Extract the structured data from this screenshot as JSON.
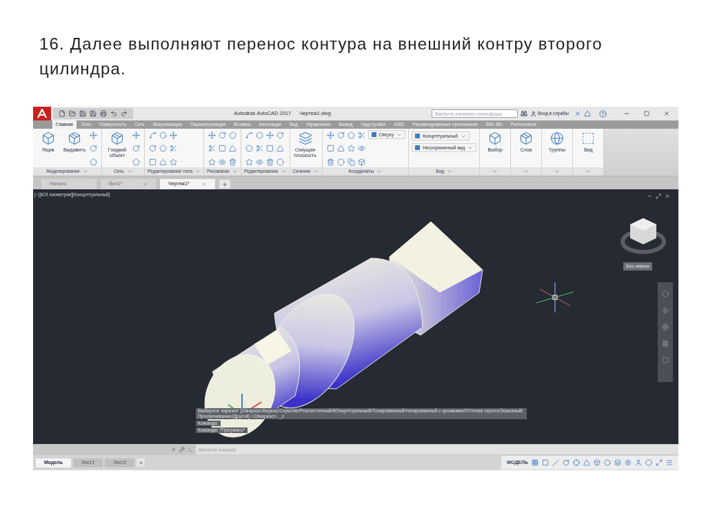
{
  "heading": "16. Далее выполняют перенос контура на внешний контру второго цилиндра.",
  "window": {
    "title": "Autodesk AutoCAD 2017",
    "file": "Чертеж1.dwg"
  },
  "search": {
    "placeholder": "Введите ключевое слово/фразу"
  },
  "sign_in": "Вход в службы",
  "ribbon_tabs": [
    {
      "label": "Главная",
      "selected": true
    },
    {
      "label": "Тело",
      "selected": false
    },
    {
      "label": "Поверхность",
      "selected": false
    },
    {
      "label": "Сеть",
      "selected": false
    },
    {
      "label": "Визуализация",
      "selected": false
    },
    {
      "label": "Параметризация",
      "selected": false
    },
    {
      "label": "Вставка",
      "selected": false
    },
    {
      "label": "Аннотации",
      "selected": false
    },
    {
      "label": "Вид",
      "selected": false
    },
    {
      "label": "Управление",
      "selected": false
    },
    {
      "label": "Вывод",
      "selected": false
    },
    {
      "label": "Надстройки",
      "selected": false
    },
    {
      "label": "A360",
      "selected": false
    },
    {
      "label": "Рекомендованные приложения",
      "selected": false
    },
    {
      "label": "BIM 360",
      "selected": false
    },
    {
      "label": "Performance",
      "selected": false
    }
  ],
  "ribbon_panels": [
    {
      "title": "Моделирование",
      "items": [
        {
          "kind": "large",
          "label": "Ящик"
        },
        {
          "kind": "large",
          "label": "Выдавить"
        },
        {
          "kind": "column"
        }
      ]
    },
    {
      "title": "Сеть",
      "items": [
        {
          "kind": "large",
          "label": "Гладкий объект"
        },
        {
          "kind": "column"
        }
      ]
    },
    {
      "title": "Редактирование тела",
      "items": [
        {
          "kind": "grid"
        }
      ]
    },
    {
      "title": "Рисование",
      "items": [
        {
          "kind": "grid"
        }
      ]
    },
    {
      "title": "Редактирование",
      "items": [
        {
          "kind": "widegrid"
        }
      ]
    },
    {
      "title": "Сечение",
      "items": [
        {
          "kind": "large",
          "label": "Секущая плоскость"
        }
      ]
    },
    {
      "title": "Координаты",
      "items": [
        {
          "kind": "widegrid"
        },
        {
          "kind": "dropdown",
          "label": "Сверху"
        }
      ]
    },
    {
      "title": "Вид",
      "items": [
        {
          "kind": "dropdown",
          "label": "Концептуальный"
        },
        {
          "kind": "dropdown",
          "label": "Несохраненный вид"
        }
      ]
    },
    {
      "items": [
        {
          "kind": "large",
          "label": "Выбор"
        }
      ]
    },
    {
      "items": [
        {
          "kind": "large",
          "label": "Слои"
        }
      ]
    },
    {
      "items": [
        {
          "kind": "large",
          "label": "Группы"
        }
      ]
    },
    {
      "items": [
        {
          "kind": "large",
          "label": "Вид"
        }
      ]
    }
  ],
  "doc_tabs": [
    {
      "label": "Начало",
      "selected": false,
      "closable": false
    },
    {
      "label": "Вал1*",
      "selected": false,
      "closable": true
    },
    {
      "label": "Чертеж1*",
      "selected": true,
      "closable": true
    }
  ],
  "viewport_label": "[−][ЮЗ изометрия][Концептуальный]",
  "viewcube_label": "Без имени",
  "command_history": [
    "Выберите вариант [2dкаркас/Каркас/Скрытие/Реалистичный/КОнцептуальный/Тонированный/тонированный с кромками/Оттенки серого/Эскизный/Просвечивание/Другой] <2dкаркас>: _c",
    "Команда:",
    "Команда: *Прервано*"
  ],
  "command_line": {
    "placeholder": "Введите команду"
  },
  "layout_tabs": [
    {
      "label": "Модель",
      "selected": true
    },
    {
      "label": "Лист1",
      "selected": false
    },
    {
      "label": "Лист2",
      "selected": false
    }
  ],
  "status_space": "МОДЕЛЬ"
}
